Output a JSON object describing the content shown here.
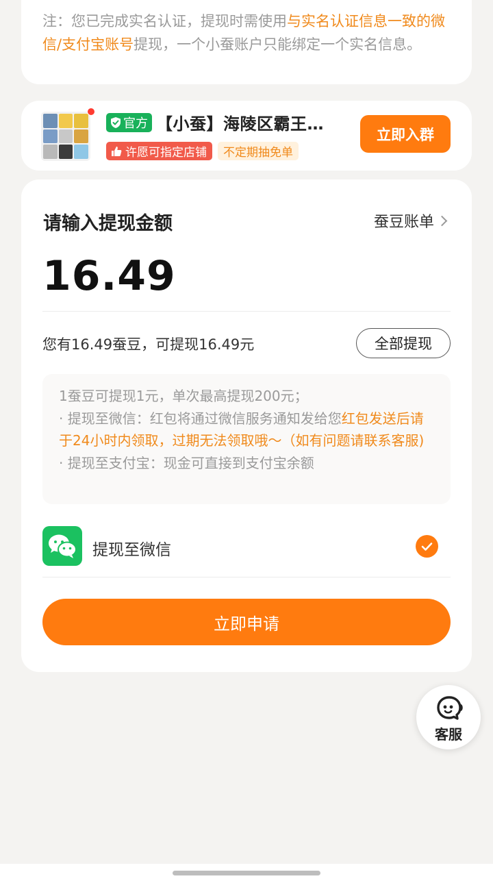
{
  "notice": {
    "prefix": "注：您已完成实名认证，提现时需使用",
    "highlight": "与实名认证信息一致的微信/支付宝账号",
    "suffix": "提现，一个小蚕账户只能绑定一个实名信息。"
  },
  "group": {
    "official_badge": "官方",
    "name": "【小蚕】海陵区霸王…",
    "tag_wish": "许愿可指定店铺",
    "tag_lottery": "不定期抽免单",
    "join_button": "立即入群",
    "avatar_colors": [
      "#6d8fb5",
      "#f2c94c",
      "#e8c03e",
      "#7a9cc6",
      "#c8c8c8",
      "#d9a441",
      "#b9b9b9",
      "#3b3b3b",
      "#8fc7e6"
    ]
  },
  "withdraw": {
    "title": "请输入提现金额",
    "bill_link": "蚕豆账单",
    "amount": "16.49",
    "balance_text": "您有16.49蚕豆，可提现16.49元",
    "withdraw_all_button": "全部提现",
    "info": {
      "line1": "1蚕豆可提现1元，单次最高提现200元；",
      "wechat_prefix": "· 提现至微信：红包将通过微信服务通知发给您",
      "wechat_highlight": "红包发送后请于24小时内领取，过期无法领取哦～（如有问题请联系客服)",
      "alipay": "· 提现至支付宝：现金可直接到支付宝余额"
    },
    "method_label": "提现至微信",
    "apply_button": "立即申请"
  },
  "service": {
    "label": "客服"
  },
  "colors": {
    "accent": "#ff7b0f",
    "wechat_green": "#1bc160",
    "official_green": "#19b15a"
  }
}
